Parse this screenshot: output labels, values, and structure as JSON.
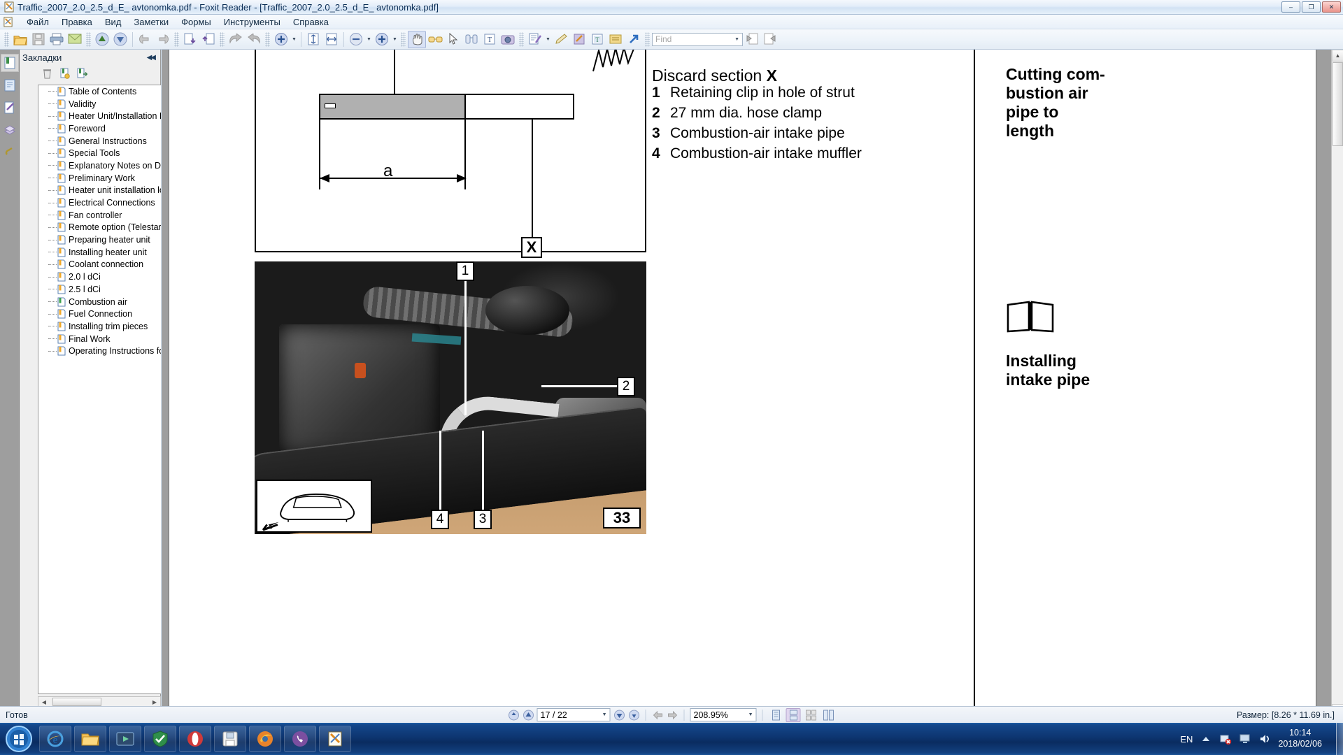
{
  "window": {
    "title": "Traffic_2007_2.0_2.5_d_E_ avtonomka.pdf - Foxit Reader - [Traffic_2007_2.0_2.5_d_E_ avtonomka.pdf]",
    "app_icon": "pdf-document-icon",
    "minimize_label": "–",
    "maximize_label": "❐",
    "close_label": "✕"
  },
  "menu": {
    "items": [
      {
        "label": "Файл"
      },
      {
        "label": "Правка"
      },
      {
        "label": "Вид"
      },
      {
        "label": "Заметки"
      },
      {
        "label": "Формы"
      },
      {
        "label": "Инструменты"
      },
      {
        "label": "Справка"
      }
    ]
  },
  "toolbar": {
    "buttons": [
      {
        "name": "open-icon"
      },
      {
        "name": "save-icon"
      },
      {
        "name": "print-icon"
      },
      {
        "name": "email-icon"
      },
      {
        "name": "scroll-up-icon"
      },
      {
        "name": "scroll-down-icon"
      },
      {
        "name": "previous-view-icon"
      },
      {
        "name": "next-view-icon"
      },
      {
        "name": "first-page-icon"
      },
      {
        "name": "last-page-icon"
      },
      {
        "name": "undo-icon"
      },
      {
        "name": "redo-icon"
      },
      {
        "name": "zoom-in-tool-icon"
      },
      {
        "name": "fit-page-icon"
      },
      {
        "name": "fit-width-icon"
      },
      {
        "name": "zoom-out-icon"
      },
      {
        "name": "zoom-in-icon"
      },
      {
        "name": "hand-tool-icon"
      },
      {
        "name": "reading-glasses-icon"
      },
      {
        "name": "select-tool-icon"
      },
      {
        "name": "snapshot-binoculars-icon"
      },
      {
        "name": "select-text-icon"
      },
      {
        "name": "camera-snapshot-icon"
      },
      {
        "name": "typewriter-icon"
      },
      {
        "name": "highlight-pen-icon"
      },
      {
        "name": "note-edit-icon"
      },
      {
        "name": "text-box-icon"
      },
      {
        "name": "sticky-note-icon"
      },
      {
        "name": "link-arrow-icon"
      }
    ],
    "find": {
      "placeholder": "Find",
      "value": ""
    },
    "find_prev": "find-previous-icon",
    "find_next": "find-next-icon"
  },
  "sidebar": {
    "panel_title": "Закладки",
    "collapse_label": "◀◀",
    "strip_icons": [
      {
        "name": "bookmarks-panel-icon"
      },
      {
        "name": "pages-panel-icon"
      },
      {
        "name": "comments-panel-icon"
      },
      {
        "name": "layers-panel-icon"
      },
      {
        "name": "attachments-panel-icon"
      }
    ],
    "tools": [
      {
        "name": "expand-bookmarks-icon"
      },
      {
        "name": "delete-bookmark-icon"
      },
      {
        "name": "new-bookmark-icon"
      },
      {
        "name": "goto-bookmark-icon"
      }
    ],
    "bookmarks": [
      {
        "label": "Table of Contents",
        "state": "normal"
      },
      {
        "label": "Validity",
        "state": "normal"
      },
      {
        "label": "Heater Unit/Installation Kit",
        "state": "normal"
      },
      {
        "label": "Foreword",
        "state": "normal"
      },
      {
        "label": "General Instructions",
        "state": "normal"
      },
      {
        "label": "Special Tools",
        "state": "normal"
      },
      {
        "label": "Explanatory Notes on Docu",
        "state": "normal"
      },
      {
        "label": "Preliminary Work",
        "state": "normal"
      },
      {
        "label": "Heater unit installation loca",
        "state": "normal"
      },
      {
        "label": "Electrical Connections",
        "state": "normal"
      },
      {
        "label": "Fan controller",
        "state": "normal"
      },
      {
        "label": "Remote option (Telestart)",
        "state": "normal"
      },
      {
        "label": "Preparing heater unit",
        "state": "normal"
      },
      {
        "label": "Installing heater unit",
        "state": "normal"
      },
      {
        "label": "Coolant connection",
        "state": "normal"
      },
      {
        "label": "2.0 l dCi",
        "state": "normal"
      },
      {
        "label": "2.5 l dCi",
        "state": "normal"
      },
      {
        "label": "Combustion air",
        "state": "current"
      },
      {
        "label": "Fuel Connection",
        "state": "normal"
      },
      {
        "label": "Installing trim pieces",
        "state": "normal"
      },
      {
        "label": "Final Work",
        "state": "normal"
      },
      {
        "label": "Operating Instructions for",
        "state": "normal"
      }
    ],
    "hscroll_left": "◀",
    "hscroll_right": "▶"
  },
  "document": {
    "discard_text": "Discard section ",
    "discard_bold": "X",
    "drawing": {
      "dimension_label": "a",
      "section_label": "X"
    },
    "legend": [
      {
        "num": "1",
        "text": "Retaining clip in hole of strut"
      },
      {
        "num": "2",
        "text": " 27 mm dia. hose clamp"
      },
      {
        "num": "3",
        "text": "Combustion-air intake pipe"
      },
      {
        "num": "4",
        "text": "Combustion-air intake muffler"
      }
    ],
    "photo_callouts": [
      {
        "num": "1"
      },
      {
        "num": "2"
      },
      {
        "num": "3"
      },
      {
        "num": "4"
      }
    ],
    "page_number": "33",
    "margin_notes": [
      {
        "text": "Cutting com-\nbustion air\npipe to\nlength"
      },
      {
        "text": "Installing\nintake pipe"
      }
    ],
    "margin_icon": "open-book-info-icon",
    "car_inset_icon": "car-top-view-icon"
  },
  "statusbar": {
    "ready_text": "Готов",
    "first_page_icon": "go-first-page-icon",
    "prev_page_icon": "go-previous-page-icon",
    "page_value": "17 / 22",
    "next_page_icon": "go-next-page-icon",
    "last_page_icon": "go-last-page-icon",
    "back_icon": "back-arrow-icon",
    "forward_icon": "forward-arrow-icon",
    "zoom_value": "208.95%",
    "view_modes": [
      {
        "name": "single-page-view-icon",
        "selected": false
      },
      {
        "name": "continuous-view-icon",
        "selected": true
      },
      {
        "name": "facing-pages-view-icon",
        "selected": false
      },
      {
        "name": "continuous-facing-view-icon",
        "selected": false
      }
    ],
    "size_text": "Размер: [8.26 * 11.69 in.]"
  },
  "taskbar": {
    "start_icon": "windows-start-orb-icon",
    "apps": [
      {
        "name": "internet-explorer-icon"
      },
      {
        "name": "file-explorer-icon"
      },
      {
        "name": "media-player-icon"
      },
      {
        "name": "antivirus-icon"
      },
      {
        "name": "opera-browser-icon"
      },
      {
        "name": "save-app-icon"
      },
      {
        "name": "firefox-icon"
      },
      {
        "name": "viber-icon"
      },
      {
        "name": "foxit-reader-icon"
      }
    ],
    "tray": {
      "language": "EN",
      "show_hidden_icon": "show-hidden-icons-icon",
      "network_icon": "network-error-icon",
      "display_icon": "display-icon",
      "volume_icon": "volume-icon",
      "time": "10:14",
      "date": "2018/02/06"
    },
    "show_desktop": "show-desktop-button"
  },
  "colors": {
    "accent": "#1d5fa8",
    "panel": "#efefef",
    "docbg": "#9e9e9e",
    "highlight": "#d9e2f5"
  }
}
